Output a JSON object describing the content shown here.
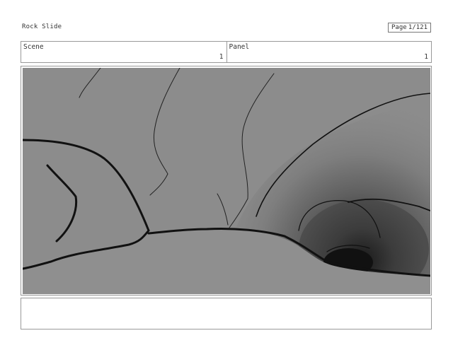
{
  "document": {
    "title": "Rock Slide"
  },
  "page": {
    "label": "Page",
    "value": "1/121"
  },
  "scene": {
    "label": "Scene",
    "value": "1"
  },
  "panel": {
    "label": "Panel",
    "value": "1"
  },
  "notes": {
    "text": ""
  }
}
